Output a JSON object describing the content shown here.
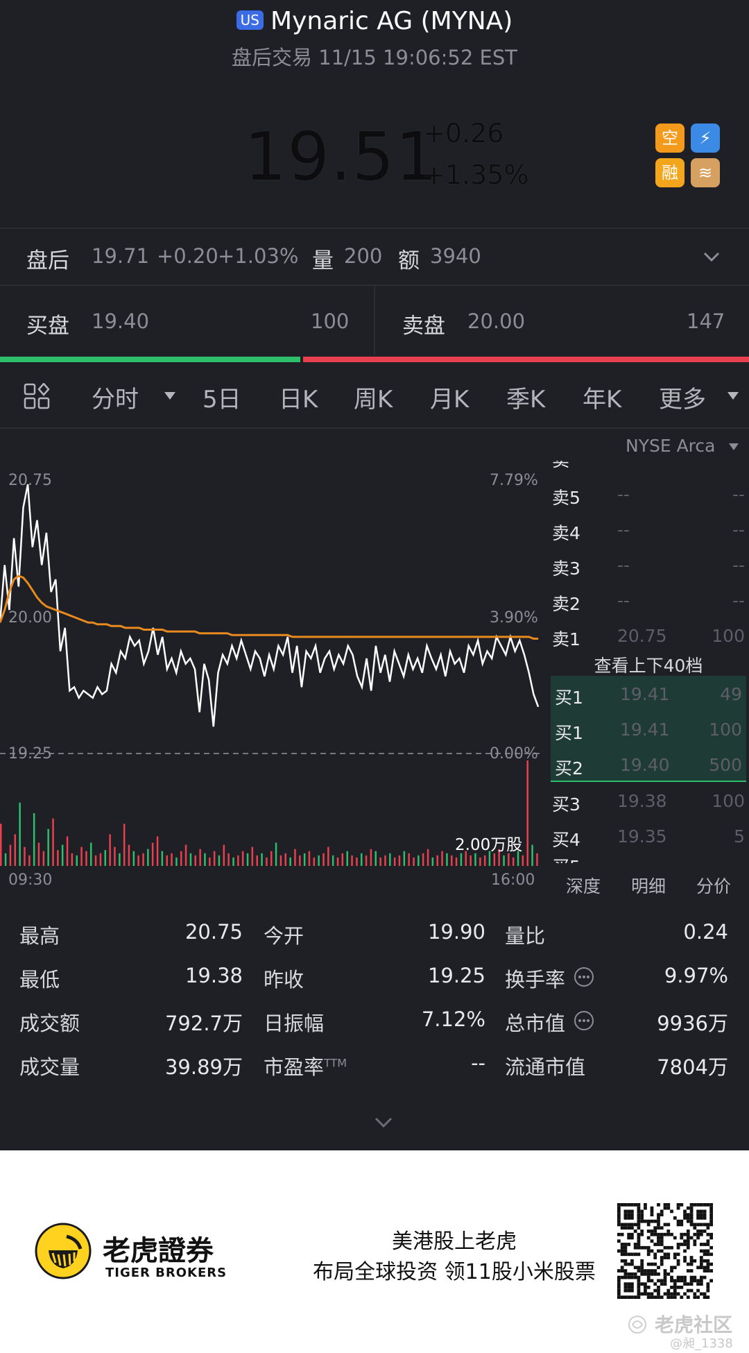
{
  "header": {
    "market_badge": "US",
    "title": "Mynaric AG (MYNA)",
    "subtitle": "盘后交易 11/15 19:06:52 EST",
    "price": "19.51",
    "change": "+0.26",
    "change_pct": "+1.35%",
    "badges": [
      {
        "icon": "short-icon",
        "text": "空",
        "color": "#f39a1c"
      },
      {
        "icon": "lightning-icon",
        "text": "⚡",
        "color": "#3b8be6"
      },
      {
        "icon": "margin-icon",
        "text": "融",
        "color": "#f3a51c"
      },
      {
        "icon": "layers-icon",
        "text": "≋",
        "color": "#d6a060"
      }
    ]
  },
  "after_hours": {
    "label": "盘后",
    "price": "19.71",
    "change": "+0.20",
    "change_pct": "+1.03%",
    "vol_label": "量",
    "vol": "200",
    "amt_label": "额",
    "amt": "3940"
  },
  "bid_ask": {
    "bid_label": "买盘",
    "bid_price": "19.40",
    "bid_qty": "100",
    "ask_label": "卖盘",
    "ask_price": "20.00",
    "ask_qty": "147",
    "bid_fraction": 0.405,
    "bid_color": "#2dbf6c",
    "ask_color": "#e8404f"
  },
  "tabs": [
    {
      "label": "分时"
    },
    {
      "label": "5日"
    },
    {
      "label": "日K"
    },
    {
      "label": "周K"
    },
    {
      "label": "月K"
    },
    {
      "label": "季K"
    },
    {
      "label": "年K"
    },
    {
      "label": "更多"
    }
  ],
  "exchange": "NYSE Arca",
  "chart_data": {
    "type": "line",
    "x_start_label": "09:30",
    "x_end_label": "16:00",
    "price_ticks": [
      "20.75",
      "20.00",
      "19.25"
    ],
    "pct_ticks": [
      "7.79%",
      "3.90%",
      "0.00%"
    ],
    "ylim": [
      19.25,
      20.75
    ],
    "prev_close": 19.25,
    "volume_label": "2.00万股",
    "series": [
      {
        "color": "#ffffff",
        "values": [
          19.98,
          20.3,
          20.05,
          20.45,
          20.18,
          20.62,
          20.75,
          20.4,
          20.55,
          20.3,
          20.48,
          20.15,
          20.22,
          19.82,
          19.95,
          19.6,
          19.62,
          19.56,
          19.6,
          19.58,
          19.56,
          19.62,
          19.58,
          19.6,
          19.75,
          19.7,
          19.82,
          19.78,
          19.9,
          19.85,
          19.88,
          19.75,
          19.82,
          19.95,
          19.8,
          19.9,
          19.72,
          19.78,
          19.7,
          19.82,
          19.75,
          19.78,
          19.72,
          19.48,
          19.75,
          19.66,
          19.4,
          19.7,
          19.8,
          19.75,
          19.85,
          19.78,
          19.88,
          19.8,
          19.72,
          19.82,
          19.78,
          19.68,
          19.8,
          19.72,
          19.85,
          19.8,
          19.9,
          19.7,
          19.85,
          19.62,
          19.82,
          19.78,
          19.85,
          19.7,
          19.78,
          19.82,
          19.72,
          19.8,
          19.75,
          19.85,
          19.8,
          19.68,
          19.62,
          19.78,
          19.6,
          19.85,
          19.7,
          19.8,
          19.65,
          19.82,
          19.75,
          19.68,
          19.8,
          19.72,
          19.78,
          19.7,
          19.85,
          19.78,
          19.72,
          19.8,
          19.68,
          19.82,
          19.75,
          19.78,
          19.7,
          19.85,
          19.8,
          19.88,
          19.75,
          19.82,
          19.78,
          19.9,
          19.85,
          19.8,
          19.9,
          19.82,
          19.88,
          19.8,
          19.7,
          19.58,
          19.51
        ]
      },
      {
        "color": "#e88a1e",
        "values": [
          19.98,
          20.05,
          20.15,
          20.22,
          20.24,
          20.23,
          20.2,
          20.16,
          20.12,
          20.09,
          20.07,
          20.06,
          20.05,
          20.04,
          20.03,
          20.02,
          20.01,
          20.0,
          19.99,
          19.98,
          19.98,
          19.97,
          19.97,
          19.97,
          19.96,
          19.96,
          19.96,
          19.95,
          19.95,
          19.95,
          19.95,
          19.94,
          19.94,
          19.94,
          19.94,
          19.94,
          19.93,
          19.93,
          19.93,
          19.93,
          19.93,
          19.93,
          19.93,
          19.92,
          19.92,
          19.92,
          19.92,
          19.92,
          19.92,
          19.92,
          19.91,
          19.91,
          19.91,
          19.91,
          19.91,
          19.91,
          19.91,
          19.91,
          19.91,
          19.91,
          19.91,
          19.91,
          19.91,
          19.9,
          19.9,
          19.9,
          19.9,
          19.9,
          19.9,
          19.9,
          19.9,
          19.9,
          19.9,
          19.9,
          19.9,
          19.9,
          19.9,
          19.9,
          19.9,
          19.9,
          19.9,
          19.9,
          19.9,
          19.9,
          19.9,
          19.9,
          19.9,
          19.9,
          19.9,
          19.9,
          19.9,
          19.9,
          19.9,
          19.9,
          19.9,
          19.9,
          19.9,
          19.9,
          19.9,
          19.9,
          19.9,
          19.9,
          19.9,
          19.9,
          19.9,
          19.9,
          19.9,
          19.9,
          19.9,
          19.9,
          19.9,
          19.9,
          19.9,
          19.9,
          19.9,
          19.89,
          19.89
        ]
      }
    ],
    "volume": [
      40,
      12,
      20,
      30,
      60,
      18,
      10,
      50,
      22,
      14,
      35,
      45,
      15,
      20,
      28,
      12,
      10,
      18,
      14,
      22,
      10,
      12,
      15,
      30,
      18,
      12,
      40,
      20,
      14,
      10,
      12,
      16,
      22,
      28,
      14,
      10,
      12,
      8,
      14,
      20,
      12,
      10,
      16,
      12,
      8,
      14,
      10,
      20,
      12,
      8,
      10,
      14,
      12,
      18,
      10,
      12,
      8,
      14,
      22,
      10,
      12,
      8,
      16,
      10,
      12,
      14,
      8,
      10,
      12,
      18,
      10,
      8,
      12,
      14,
      10,
      8,
      12,
      10,
      16,
      14,
      8,
      10,
      12,
      8,
      10,
      14,
      12,
      8,
      10,
      12,
      16,
      8,
      10,
      14,
      12,
      10,
      8,
      12,
      14,
      10,
      12,
      8,
      10,
      14,
      12,
      16,
      10,
      12,
      8,
      14,
      10,
      100,
      20,
      12
    ]
  },
  "orderbook": {
    "asks": [
      {
        "side": "卖5",
        "price": "--",
        "qty": "--"
      },
      {
        "side": "卖4",
        "price": "--",
        "qty": "--"
      },
      {
        "side": "卖3",
        "price": "--",
        "qty": "--"
      },
      {
        "side": "卖2",
        "price": "--",
        "qty": "--"
      },
      {
        "side": "卖1",
        "price": "20.75",
        "qty": "100"
      }
    ],
    "view_more": "查看上下40档",
    "bids": [
      {
        "side": "买1",
        "price": "19.41",
        "qty": "49"
      },
      {
        "side": "买1",
        "price": "19.41",
        "qty": "100"
      },
      {
        "side": "买2",
        "price": "19.40",
        "qty": "500"
      },
      {
        "side": "买3",
        "price": "19.38",
        "qty": "100"
      },
      {
        "side": "买4",
        "price": "19.35",
        "qty": "5"
      }
    ],
    "tabs": [
      "深度",
      "明细",
      "分价"
    ]
  },
  "stats": [
    [
      {
        "label": "最高",
        "value": "20.75"
      },
      {
        "label": "今开",
        "value": "19.90"
      },
      {
        "label": "量比",
        "value": "0.24"
      }
    ],
    [
      {
        "label": "最低",
        "value": "19.38"
      },
      {
        "label": "昨收",
        "value": "19.25"
      },
      {
        "label": "换手率",
        "value": "9.97%"
      }
    ],
    [
      {
        "label": "成交额",
        "value": "792.7万"
      },
      {
        "label": "日振幅",
        "value": "7.12%"
      },
      {
        "label": "总市值",
        "value": "9936万"
      }
    ],
    [
      {
        "label": "成交量",
        "value": "39.89万"
      },
      {
        "label": "市盈率",
        "sup": "TTM",
        "value": "--"
      },
      {
        "label": "流通市值",
        "value": "7804万"
      }
    ]
  ],
  "footer": {
    "brand_cn": "老虎證券",
    "brand_en": "TIGER BROKERS",
    "slogan1": "美港股上老虎",
    "slogan2": "布局全球投资 领11股小米股票",
    "watermark": "老虎社区",
    "watermark_user": "@昶_1338"
  }
}
